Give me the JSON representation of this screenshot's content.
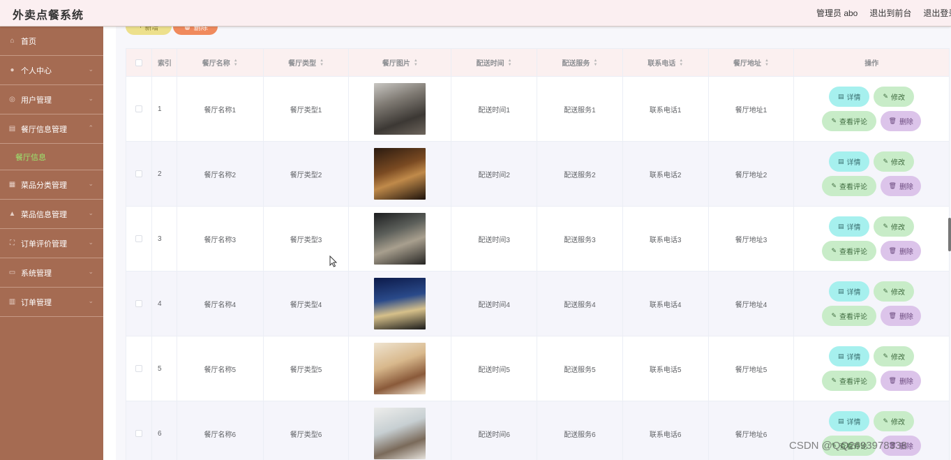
{
  "app": {
    "title": "外卖点餐系统",
    "user": "管理员 abo",
    "to_front": "退出到前台",
    "logout": "退出登录"
  },
  "sidebar": {
    "items": [
      {
        "label": "首页",
        "icon": "home-icon",
        "chevron": false
      },
      {
        "label": "个人中心",
        "icon": "user-icon",
        "chevron": true
      },
      {
        "label": "用户管理",
        "icon": "users-icon",
        "chevron": true
      },
      {
        "label": "餐厅信息管理",
        "icon": "shop-icon",
        "chevron": true,
        "expanded": true,
        "sub": "餐厅信息"
      },
      {
        "label": "菜品分类管理",
        "icon": "category-icon",
        "chevron": true
      },
      {
        "label": "菜品信息管理",
        "icon": "dish-icon",
        "chevron": true
      },
      {
        "label": "订单评价管理",
        "icon": "comment-icon",
        "chevron": true
      },
      {
        "label": "系统管理",
        "icon": "system-icon",
        "chevron": true
      },
      {
        "label": "订单管理",
        "icon": "order-icon",
        "chevron": true
      }
    ],
    "active_sub": "餐厅信息"
  },
  "toolbar": {
    "add_label": "新增",
    "delete_label": "删除"
  },
  "table": {
    "headers": [
      "索引",
      "餐厅名称",
      "餐厅类型",
      "餐厅图片",
      "配送时间",
      "配送服务",
      "联系电话",
      "餐厅地址",
      "操作"
    ],
    "rows": [
      {
        "index": "1",
        "name": "餐厅名称1",
        "type": "餐厅类型1",
        "time": "配送时间1",
        "service": "配送服务1",
        "phone": "联系电话1",
        "address": "餐厅地址1"
      },
      {
        "index": "2",
        "name": "餐厅名称2",
        "type": "餐厅类型2",
        "time": "配送时间2",
        "service": "配送服务2",
        "phone": "联系电话2",
        "address": "餐厅地址2"
      },
      {
        "index": "3",
        "name": "餐厅名称3",
        "type": "餐厅类型3",
        "time": "配送时间3",
        "service": "配送服务3",
        "phone": "联系电话3",
        "address": "餐厅地址3"
      },
      {
        "index": "4",
        "name": "餐厅名称4",
        "type": "餐厅类型4",
        "time": "配送时间4",
        "service": "配送服务4",
        "phone": "联系电话4",
        "address": "餐厅地址4"
      },
      {
        "index": "5",
        "name": "餐厅名称5",
        "type": "餐厅类型5",
        "time": "配送时间5",
        "service": "配送服务5",
        "phone": "联系电话5",
        "address": "餐厅地址5"
      },
      {
        "index": "6",
        "name": "餐厅名称6",
        "type": "餐厅类型6",
        "time": "配送时间6",
        "service": "配送服务6",
        "phone": "联系电话6",
        "address": "餐厅地址6"
      }
    ],
    "actions": {
      "detail": "详情",
      "edit": "修改",
      "review": "查看评论",
      "delete": "删除"
    }
  },
  "colors": {
    "sidebar": "#a56b52",
    "active_sub": "#9be86f",
    "detail_btn": "#a6f0ee",
    "edit_btn": "#c8ecc8",
    "delete_btn": "#dcc4ea"
  },
  "watermark": "CSDN @QQ2693978338"
}
